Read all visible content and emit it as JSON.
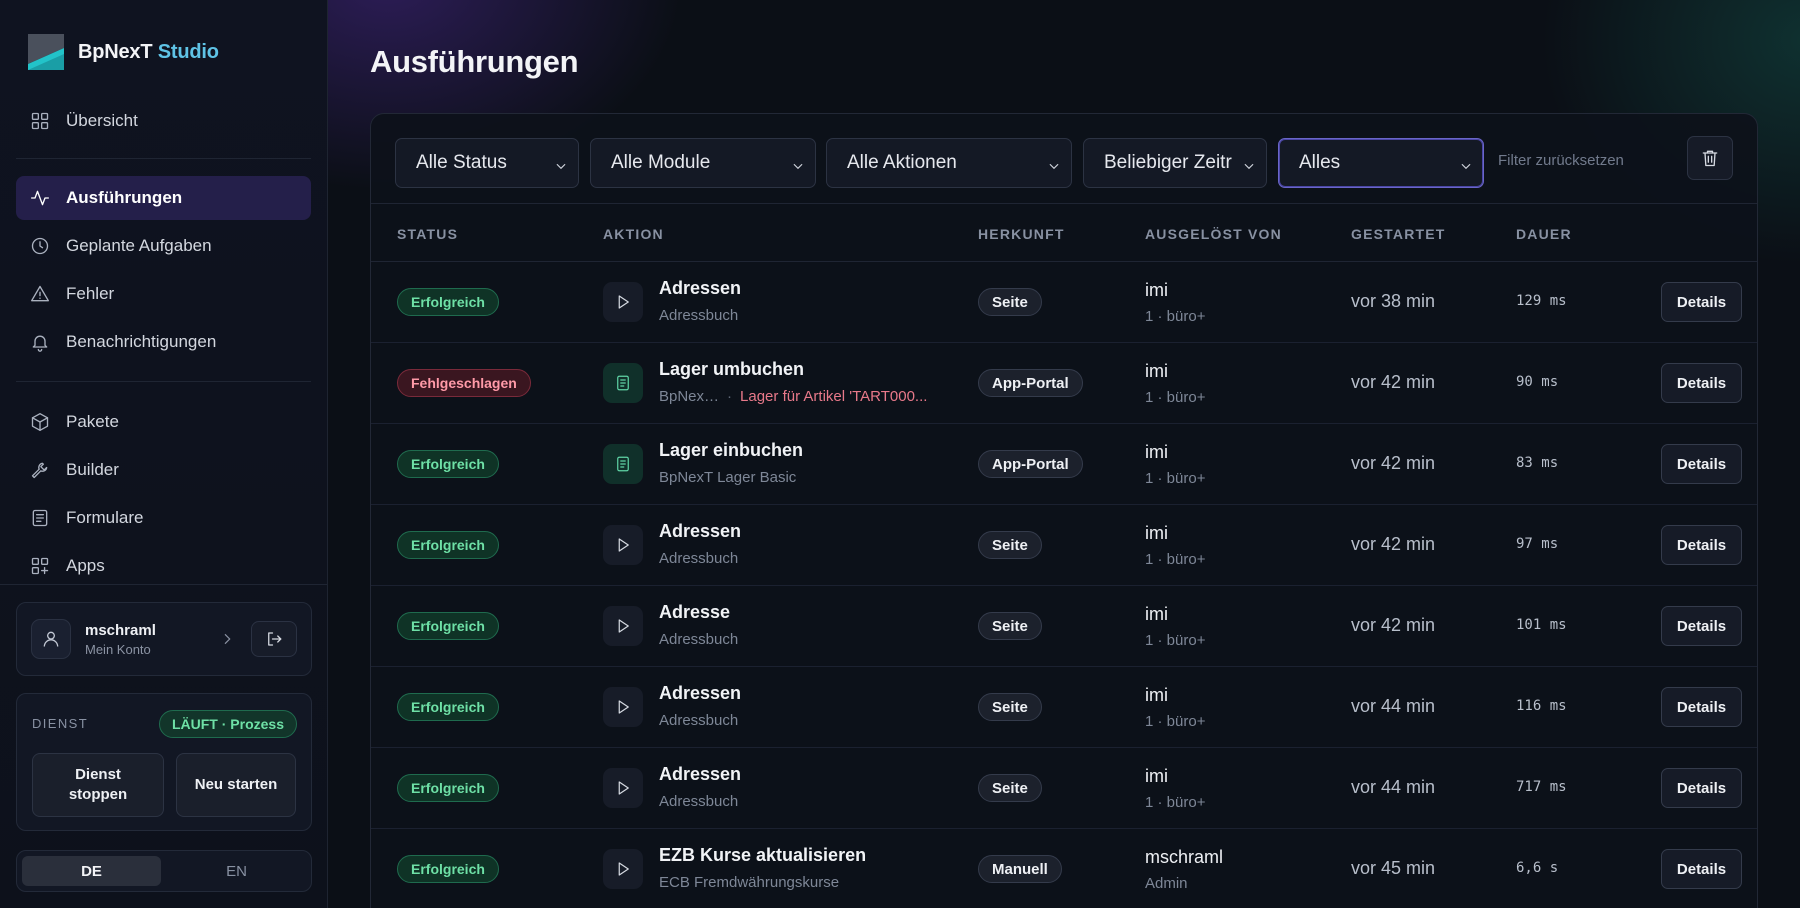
{
  "brand": {
    "name": "BpNexT",
    "accent": "Studio"
  },
  "sidebar": {
    "nav_top": [
      {
        "label": "Übersicht",
        "icon": "grid-icon"
      }
    ],
    "nav_main": [
      {
        "label": "Ausführungen",
        "icon": "activity-icon",
        "active": true
      },
      {
        "label": "Geplante Aufgaben",
        "icon": "clock-icon"
      },
      {
        "label": "Fehler",
        "icon": "warning-icon"
      },
      {
        "label": "Benachrichtigungen",
        "icon": "bell-icon"
      }
    ],
    "nav_tools": [
      {
        "label": "Pakete",
        "icon": "package-icon"
      },
      {
        "label": "Builder",
        "icon": "wrench-icon"
      },
      {
        "label": "Formulare",
        "icon": "form-icon"
      },
      {
        "label": "Apps",
        "icon": "apps-icon"
      }
    ],
    "account": {
      "name": "mschraml",
      "sub": "Mein Konto"
    },
    "service": {
      "label": "DIENST",
      "status": "LÄUFT · Prozess",
      "stop_label_line1": "Dienst",
      "stop_label_line2": "stoppen",
      "restart_label": "Neu starten"
    },
    "language": {
      "options": [
        "DE",
        "EN"
      ],
      "selected": "DE"
    }
  },
  "main": {
    "title": "Ausführungen",
    "filters": {
      "status": "Alle Status",
      "module": "Alle Module",
      "action": "Alle Aktionen",
      "time": "Beliebiger Zeitraum",
      "scope": "Alles",
      "reset": "Filter zurücksetzen"
    },
    "columns": {
      "status": "STATUS",
      "action": "AKTION",
      "origin": "HERKUNFT",
      "triggered_by": "AUSGELÖST VON",
      "started": "GESTARTET",
      "duration": "DAUER"
    },
    "details_label": "Details",
    "rows": [
      {
        "status": "Erfolgreich",
        "status_type": "ok",
        "icon": "play-icon",
        "title": "Adressen",
        "sub": "Adressbuch",
        "sub_error": "",
        "origin": "Seite",
        "trig_name": "imi",
        "trig_sub": "1 · büro+",
        "started": "vor 38 min",
        "duration": "129 ms"
      },
      {
        "status": "Fehlgeschlagen",
        "status_type": "err",
        "icon": "form-icon",
        "title": "Lager umbuchen",
        "sub": "BpNex…",
        "sub_error": "Lager für Artikel 'TART000...",
        "origin": "App-Portal",
        "trig_name": "imi",
        "trig_sub": "1 · büro+",
        "started": "vor 42 min",
        "duration": "90 ms"
      },
      {
        "status": "Erfolgreich",
        "status_type": "ok",
        "icon": "form-icon",
        "title": "Lager einbuchen",
        "sub": "BpNexT Lager Basic",
        "sub_error": "",
        "origin": "App-Portal",
        "trig_name": "imi",
        "trig_sub": "1 · büro+",
        "started": "vor 42 min",
        "duration": "83 ms"
      },
      {
        "status": "Erfolgreich",
        "status_type": "ok",
        "icon": "play-icon",
        "title": "Adressen",
        "sub": "Adressbuch",
        "sub_error": "",
        "origin": "Seite",
        "trig_name": "imi",
        "trig_sub": "1 · büro+",
        "started": "vor 42 min",
        "duration": "97 ms"
      },
      {
        "status": "Erfolgreich",
        "status_type": "ok",
        "icon": "play-icon",
        "title": "Adresse",
        "sub": "Adressbuch",
        "sub_error": "",
        "origin": "Seite",
        "trig_name": "imi",
        "trig_sub": "1 · büro+",
        "started": "vor 42 min",
        "duration": "101 ms"
      },
      {
        "status": "Erfolgreich",
        "status_type": "ok",
        "icon": "play-icon",
        "title": "Adressen",
        "sub": "Adressbuch",
        "sub_error": "",
        "origin": "Seite",
        "trig_name": "imi",
        "trig_sub": "1 · büro+",
        "started": "vor 44 min",
        "duration": "116 ms"
      },
      {
        "status": "Erfolgreich",
        "status_type": "ok",
        "icon": "play-icon",
        "title": "Adressen",
        "sub": "Adressbuch",
        "sub_error": "",
        "origin": "Seite",
        "trig_name": "imi",
        "trig_sub": "1 · büro+",
        "started": "vor 44 min",
        "duration": "717 ms"
      },
      {
        "status": "Erfolgreich",
        "status_type": "ok",
        "icon": "play-icon",
        "title": "EZB Kurse aktualisieren",
        "sub": "ECB Fremdwährungskurse",
        "sub_error": "",
        "origin": "Manuell",
        "trig_name": "mschraml",
        "trig_sub": "Admin",
        "started": "vor 45 min",
        "duration": "6,6 s"
      }
    ]
  },
  "colors": {
    "accent": "#5fc3e6",
    "success": "#6ee0a6",
    "error": "#ff9aa8",
    "active_nav": "#241f4a"
  }
}
